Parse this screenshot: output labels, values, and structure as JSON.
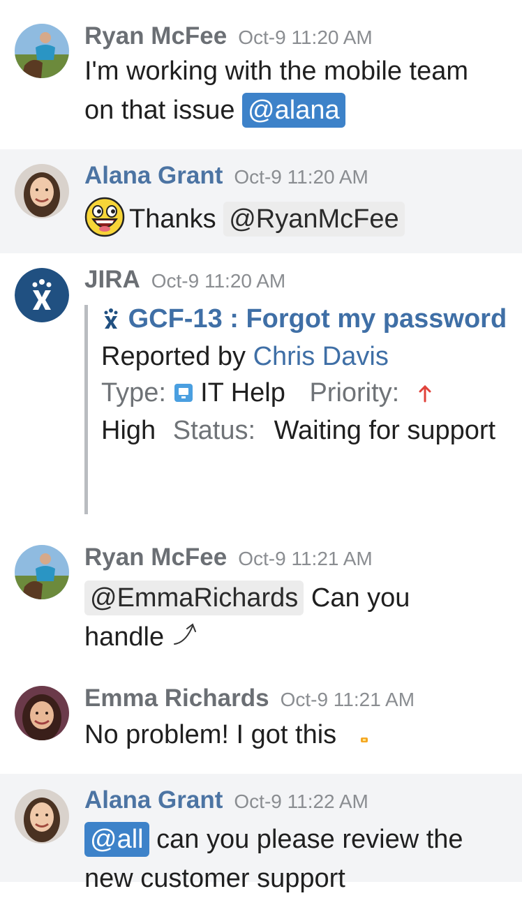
{
  "messages": [
    {
      "author": "Ryan McFee",
      "time": "Oct-9 11:20 AM",
      "text_before": "I'm working with the mobile team on that issue",
      "mention": "@alana"
    },
    {
      "author": "Alana Grant",
      "time": "Oct-9 11:20 AM",
      "text_before": "Thanks",
      "mention": "@RyanMcFee"
    },
    {
      "author": "JIRA",
      "time": "Oct-9 11:20 AM",
      "issue_title": "GCF-13 : Forgot my password",
      "reported_by_label": "Reported by",
      "reporter": "Chris Davis",
      "type_label": "Type:",
      "type_value": "IT Help",
      "priority_label": "Priority:",
      "priority_value": "High",
      "status_label": "Status:",
      "status_value": "Waiting for support"
    },
    {
      "author": "Ryan McFee",
      "time": "Oct-9 11:21 AM",
      "mention": "@EmmaRichards",
      "text_after": "Can you handle"
    },
    {
      "author": "Emma Richards",
      "time": "Oct-9 11:21 AM",
      "text_before": "No problem! I got this"
    },
    {
      "author": "Alana Grant",
      "time": "Oct-9 11:22 AM",
      "mention": "@all",
      "text_after": "can you please review the new customer support"
    }
  ],
  "colors": {
    "mention_self_bg": "#3d82c9",
    "mention_other_bg": "#ececec",
    "author_highlight": "#4c74a3",
    "link": "#3f6fa6",
    "highlight_row_bg": "#f3f4f6",
    "priority_high": "#e0423a"
  },
  "icons": {
    "jira_avatar": "jira-logo-icon",
    "issue_type": "it-help-monitor-icon",
    "priority": "arrow-up-icon",
    "share": "curved-arrow-icon",
    "emoji": "awesome-face-emoji-icon"
  }
}
